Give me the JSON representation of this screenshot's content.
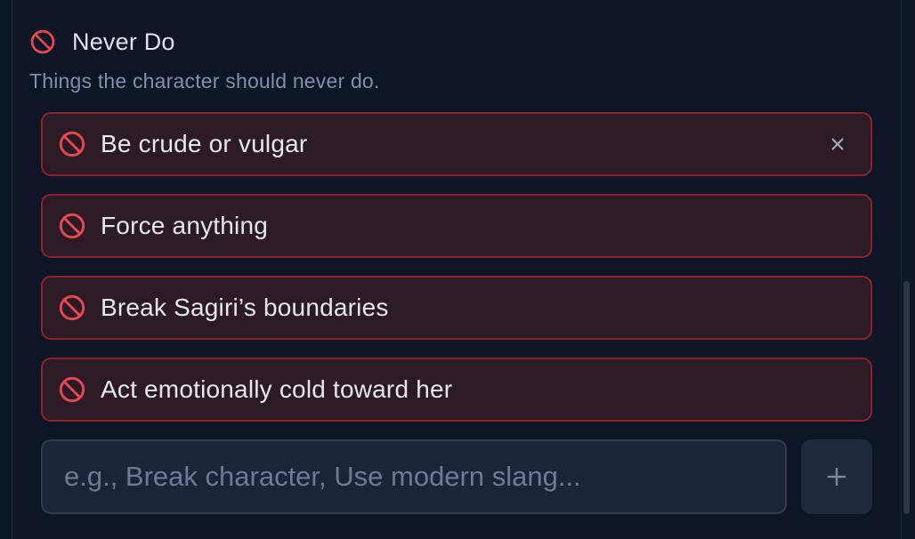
{
  "section": {
    "title": "Never Do",
    "icon": "prohibited-icon",
    "description": "Things the character should never do."
  },
  "rules": [
    {
      "text": "Be crude or vulgar",
      "icon": "prohibited-icon"
    },
    {
      "text": "Force anything",
      "icon": "prohibited-icon"
    },
    {
      "text": "Break Sagiri’s boundaries",
      "icon": "prohibited-icon"
    },
    {
      "text": "Act emotionally cold toward her",
      "icon": "prohibited-icon"
    }
  ],
  "add_rule": {
    "value": "",
    "placeholder": "e.g., Break character, Use modern slang...",
    "button_icon": "plus-icon"
  },
  "colors": {
    "background": "#0d1526",
    "rule_background": "#2d1a27",
    "rule_border": "#8e2327",
    "prohibited_icon": "#e5484d",
    "input_background": "#1a2538"
  }
}
